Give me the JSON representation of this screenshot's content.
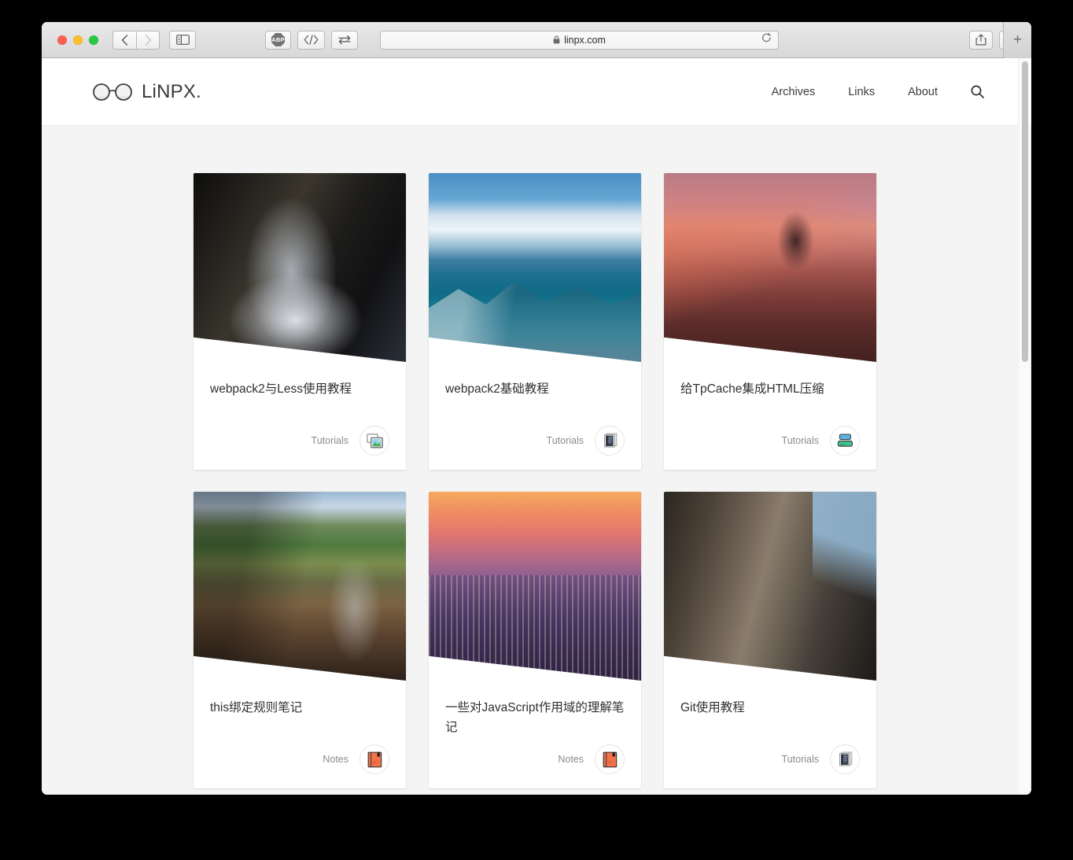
{
  "browser": {
    "url": "linpx.com",
    "lock_icon": "lock-icon",
    "back_icon": "chevron-left-icon",
    "forward_icon": "chevron-right-icon",
    "sidebar_icon": "sidebar-icon",
    "adblock_label": "ABP",
    "devtools_icon": "code-brackets-icon",
    "swap_icon": "swap-arrows-icon",
    "reload_icon": "reload-icon",
    "share_icon": "share-icon",
    "tabs_overview_icon": "tab-overview-icon",
    "new_tab_label": "+"
  },
  "site": {
    "brand": "LiNPX.",
    "brand_icon": "glasses-icon",
    "nav": [
      {
        "label": "Archives",
        "name": "nav-archives"
      },
      {
        "label": "Links",
        "name": "nav-links"
      },
      {
        "label": "About",
        "name": "nav-about"
      }
    ],
    "search_icon": "search-icon"
  },
  "posts": [
    {
      "title": "webpack2与Less使用教程",
      "category": "Tutorials",
      "icon": "photos-stack-icon",
      "photo": "ph-waterfall"
    },
    {
      "title": "webpack2基础教程",
      "category": "Tutorials",
      "icon": "notebook-dark-icon",
      "photo": "ph-mountain"
    },
    {
      "title": "给TpCache集成HTML压缩",
      "category": "Tutorials",
      "icon": "stacked-servers-icon",
      "photo": "ph-desert"
    },
    {
      "title": "this绑定规则笔记",
      "category": "Notes",
      "icon": "orange-book-icon",
      "photo": "ph-canyon"
    },
    {
      "title": "一些对JavaScript作用域的理解笔记",
      "category": "Notes",
      "icon": "orange-book-icon",
      "photo": "ph-city"
    },
    {
      "title": "Git使用教程",
      "category": "Tutorials",
      "icon": "notebook-dark-icon",
      "photo": "ph-cliff"
    }
  ],
  "colors": {
    "page_background": "#f4f4f4",
    "card_background": "#ffffff",
    "title_text": "#303030",
    "category_text": "#8b8b8b",
    "nav_text": "#3c3c3c",
    "notes_icon_accent": "#f2734a",
    "tutorials_icon_blue": "#5ab4e0",
    "tutorials_icon_green": "#3ec28b"
  }
}
